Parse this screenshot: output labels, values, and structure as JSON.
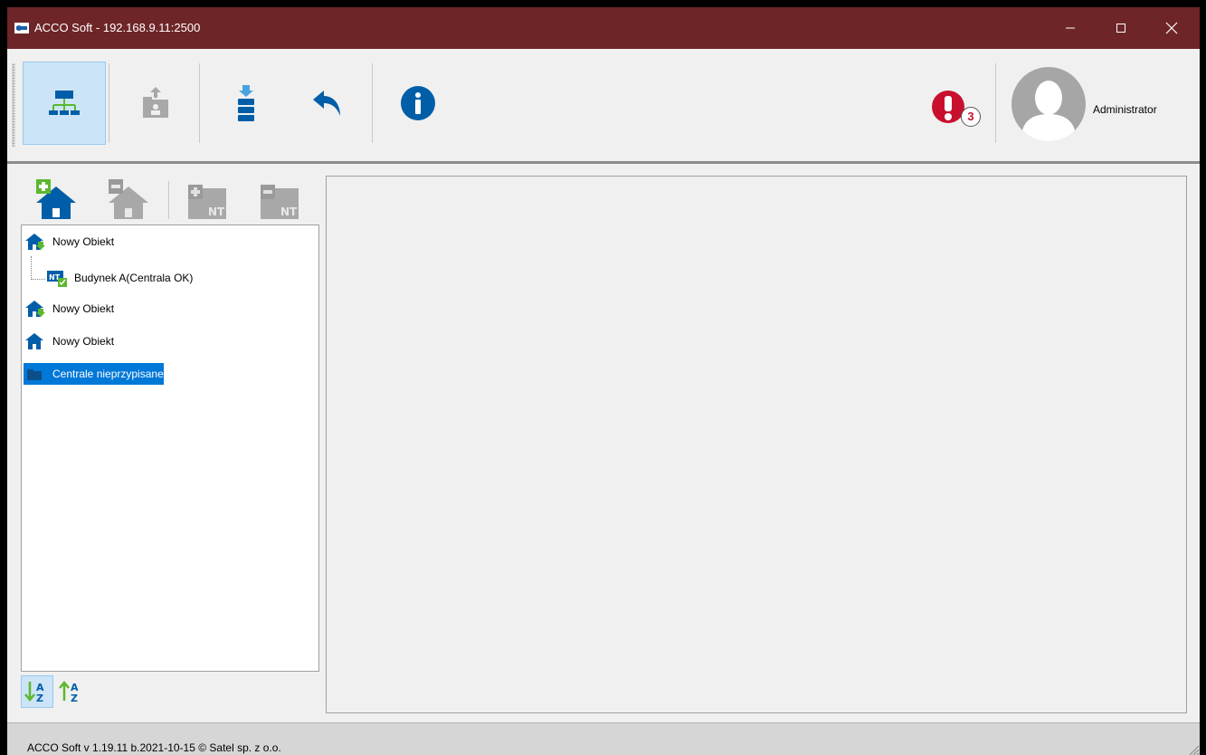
{
  "window": {
    "title": "ACCO Soft - 192.168.9.11:2500"
  },
  "toolbar": {
    "buttons": [
      {
        "name": "structure-view",
        "icon": "network-tree-icon",
        "active": true
      },
      {
        "name": "users",
        "icon": "user-folder-icon",
        "active": false
      },
      {
        "name": "save",
        "icon": "database-download-icon",
        "active": false
      },
      {
        "name": "undo",
        "icon": "undo-arrow-icon",
        "active": false
      },
      {
        "name": "info",
        "icon": "info-icon",
        "active": false
      }
    ],
    "alerts_count": "3",
    "user_name": "Administrator"
  },
  "left_panel": {
    "tools": [
      {
        "name": "add-object",
        "icon": "house-plus-icon",
        "enabled": true
      },
      {
        "name": "remove-object",
        "icon": "house-minus-icon",
        "enabled": false
      },
      {
        "name": "add-network",
        "icon": "nt-plus-icon",
        "enabled": false
      },
      {
        "name": "remove-network",
        "icon": "nt-minus-icon",
        "enabled": false
      }
    ],
    "tree": [
      {
        "label": "Nowy Obiekt",
        "icon": "house-download-icon",
        "level": 0
      },
      {
        "label": "Budynek A(Centrala OK)",
        "icon": "nt-check-icon",
        "level": 1
      },
      {
        "label": "Nowy Obiekt",
        "icon": "house-download-icon",
        "level": 0
      },
      {
        "label": "Nowy Obiekt",
        "icon": "house-icon",
        "level": 0
      },
      {
        "label": "Centrale nieprzypisane",
        "icon": "folder-icon",
        "level": 0,
        "selected": true
      }
    ],
    "sort": [
      {
        "name": "sort-ascending",
        "icon": "sort-az-down-icon",
        "active": true
      },
      {
        "name": "sort-descending",
        "icon": "sort-az-up-icon",
        "active": false
      }
    ]
  },
  "statusbar": {
    "text": "ACCO Soft v 1.19.11 b.2021-10-15   © Satel sp. z o.o."
  },
  "colors": {
    "titlebar": "#6e2527",
    "accent_blue": "#005ea8",
    "accent_green": "#5cb82e",
    "alert_red": "#c8102e",
    "selection": "#0078d7"
  }
}
